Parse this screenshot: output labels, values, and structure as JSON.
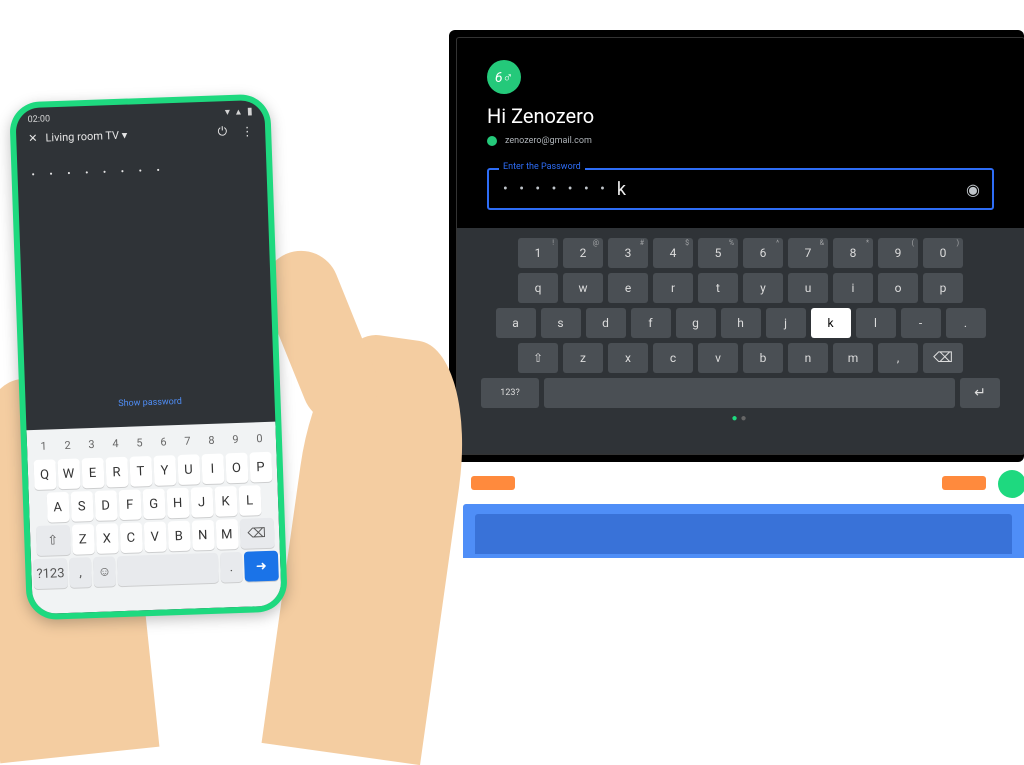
{
  "phone": {
    "status_time": "02:00",
    "status_icons": {
      "wifi": "▾",
      "signal": "▴",
      "battery": "▮"
    },
    "cast_close_icon": "✕",
    "cast_device": "Living room TV",
    "cast_chevron": "▾",
    "power_icon": "⏻",
    "more_icon": "⋮",
    "password_dots": "• • • • • • • •",
    "show_password": "Show password",
    "keyboard": {
      "num_row": [
        "1",
        "2",
        "3",
        "4",
        "5",
        "6",
        "7",
        "8",
        "9",
        "0"
      ],
      "row_q": [
        "Q",
        "W",
        "E",
        "R",
        "T",
        "Y",
        "U",
        "I",
        "O",
        "P"
      ],
      "row_a": [
        "A",
        "S",
        "D",
        "F",
        "G",
        "H",
        "J",
        "K",
        "L"
      ],
      "shift_icon": "⇧",
      "row_z": [
        "Z",
        "X",
        "C",
        "V",
        "B",
        "N",
        "M"
      ],
      "backspace_icon": "⌫",
      "sym_label": "?123",
      "comma": ",",
      "emoji_icon": "☺",
      "space": " ",
      "dot": ".",
      "enter_icon": "➜"
    }
  },
  "tv": {
    "avatar_text": "6♂",
    "greeting": "Hi Zenozero",
    "email": "zenozero@gmail.com",
    "pw_label": "Enter the Password",
    "pw_dots": "• • • • • • •",
    "pw_visible_char": "k",
    "eye_icon": "◉",
    "keyboard": {
      "row1": [
        {
          "k": "1",
          "s": "!"
        },
        {
          "k": "2",
          "s": "@"
        },
        {
          "k": "3",
          "s": "#"
        },
        {
          "k": "4",
          "s": "$"
        },
        {
          "k": "5",
          "s": "%"
        },
        {
          "k": "6",
          "s": "^"
        },
        {
          "k": "7",
          "s": "&"
        },
        {
          "k": "8",
          "s": "*"
        },
        {
          "k": "9",
          "s": "("
        },
        {
          "k": "0",
          "s": ")"
        }
      ],
      "row2": [
        "q",
        "w",
        "e",
        "r",
        "t",
        "y",
        "u",
        "i",
        "o",
        "p"
      ],
      "row3": [
        "a",
        "s",
        "d",
        "f",
        "g",
        "h",
        "j",
        "k",
        "l",
        "-",
        "."
      ],
      "active_key": "k",
      "shift_icon": "⇧",
      "row4": [
        "z",
        "x",
        "c",
        "v",
        "b",
        "n",
        "m",
        ","
      ],
      "backspace_icon": "⌫",
      "sym_label": "123?",
      "enter_icon": "↵"
    },
    "pager": [
      "●",
      "●"
    ]
  }
}
